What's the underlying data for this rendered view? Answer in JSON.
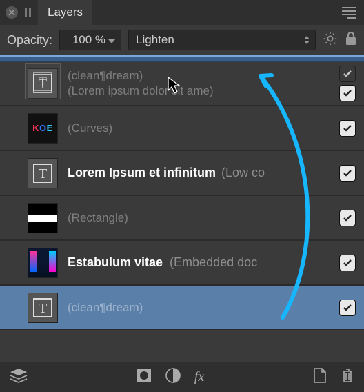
{
  "header": {
    "tab_label": "Layers"
  },
  "controls": {
    "opacity_label": "Opacity:",
    "opacity_value": "100 %",
    "blend_mode": "Lighten"
  },
  "layers": [
    {
      "name": "(clean¶dream)",
      "sub": "(Lorem ipsum dolor sit ame)",
      "ghost": true,
      "visible": true,
      "thumb": "text"
    },
    {
      "name": "(Curves)",
      "ghost": true,
      "visible": true,
      "thumb": "koe"
    },
    {
      "name_main": "Lorem Ipsum et infinitum",
      "name_sec": "(Low co",
      "visible": true,
      "thumb": "text"
    },
    {
      "name": "(Rectangle)",
      "ghost": true,
      "visible": true,
      "thumb": "rect"
    },
    {
      "name_main": "Estabulum vitae",
      "name_sec": "(Embedded doc",
      "visible": true,
      "thumb": "photo"
    },
    {
      "name": "(clean¶dream)",
      "ghost": true,
      "visible": true,
      "selected": true,
      "thumb": "text"
    }
  ],
  "icons": {
    "close": "close",
    "pause": "pause",
    "menu": "menu",
    "gear": "gear",
    "lock": "lock",
    "layers_stack": "layers",
    "mask": "mask",
    "adjust": "adjustment",
    "fx": "fx",
    "new_layer": "new-layer",
    "trash": "trash"
  }
}
